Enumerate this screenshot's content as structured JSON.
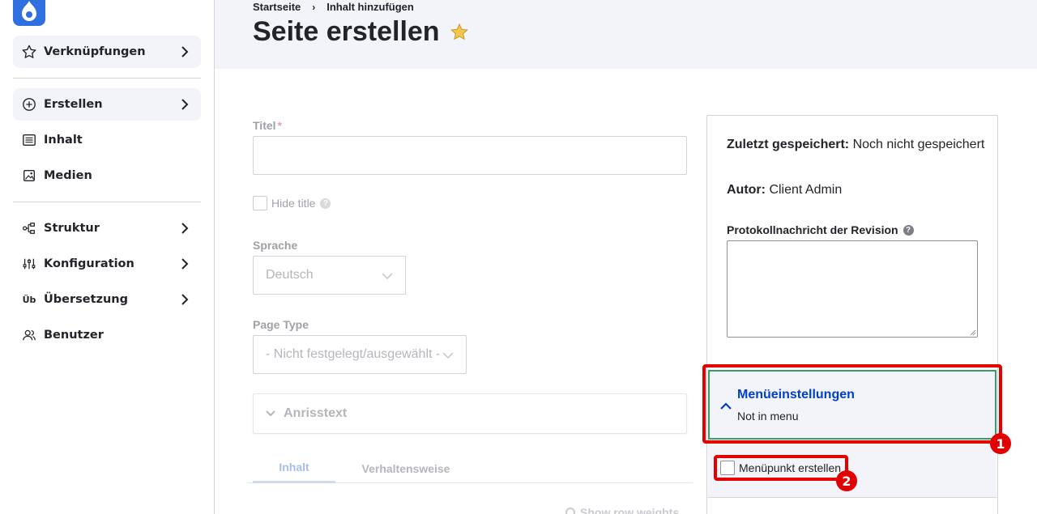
{
  "sidebar": {
    "items": [
      {
        "label": "Verknüpfungen",
        "icon": "star-icon"
      },
      {
        "label": "Erstellen",
        "icon": "plus-circle-icon"
      },
      {
        "label": "Inhalt",
        "icon": "list-icon"
      },
      {
        "label": "Medien",
        "icon": "image-icon"
      },
      {
        "label": "Struktur",
        "icon": "structure-icon"
      },
      {
        "label": "Konfiguration",
        "icon": "sliders-icon"
      },
      {
        "label": "Übersetzung",
        "icon": "translate-icon",
        "glyph": "Üb"
      },
      {
        "label": "Benutzer",
        "icon": "users-icon"
      }
    ]
  },
  "breadcrumb": [
    "Startseite",
    "Inhalt hinzufügen"
  ],
  "page_title": "Seite erstellen",
  "form": {
    "title_label": "Titel",
    "required_mark": "*",
    "hide_title_label": "Hide title",
    "language_label": "Sprache",
    "language_value": "Deutsch",
    "page_type_label": "Page Type",
    "page_type_value": "- Nicht festgelegt/ausgewählt -",
    "teaser_label": "Anrisstext",
    "tabs": [
      "Inhalt",
      "Verhaltensweise"
    ],
    "show_row_weights": "Show row weights"
  },
  "meta": {
    "last_saved_label": "Zuletzt gespeichert:",
    "last_saved_value": "Noch nicht gespeichert",
    "author_label": "Autor:",
    "author_value": "Client Admin",
    "revision_label": "Protokollnachricht der Revision",
    "menu_title": "Menüeinstellungen",
    "menu_status": "Not in menu",
    "menu_checkbox_label": "Menüpunkt erstellen"
  },
  "annotations": [
    "1",
    "2"
  ],
  "colors": {
    "accent": "#003ecc",
    "highlight": "#e30000",
    "focus_border": "#3a9b6b",
    "star": "#f3c64c"
  }
}
